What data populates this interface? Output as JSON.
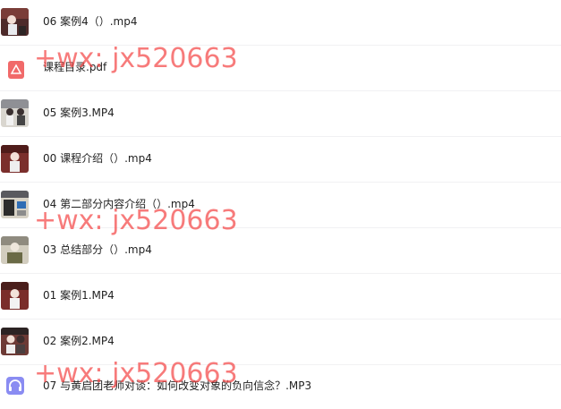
{
  "files": [
    {
      "name": "06 案例4（）.mp4",
      "type": "video"
    },
    {
      "name": "课程目录.pdf",
      "type": "pdf"
    },
    {
      "name": "05 案例3.MP4",
      "type": "video"
    },
    {
      "name": "00 课程介绍（）.mp4",
      "type": "video"
    },
    {
      "name": "04 第二部分内容介绍（）.mp4",
      "type": "video"
    },
    {
      "name": "03 总结部分（）.mp4",
      "type": "video"
    },
    {
      "name": "01 案例1.MP4",
      "type": "video"
    },
    {
      "name": "02 案例2.MP4",
      "type": "video"
    },
    {
      "name": "07 与黄启团老师对谈：如何改变对象的负向信念？.MP3",
      "type": "audio"
    }
  ],
  "watermarks": [
    "+wx: jx520663",
    "+wx: jx520663",
    "+wx: jx520663"
  ],
  "icons": {
    "pdf": "pdf-icon",
    "audio": "headphones-icon",
    "video": "video-thumbnail"
  },
  "colors": {
    "watermark": "#f44848",
    "pdf": "#f16a6a",
    "audio": "#8a8cf2"
  }
}
